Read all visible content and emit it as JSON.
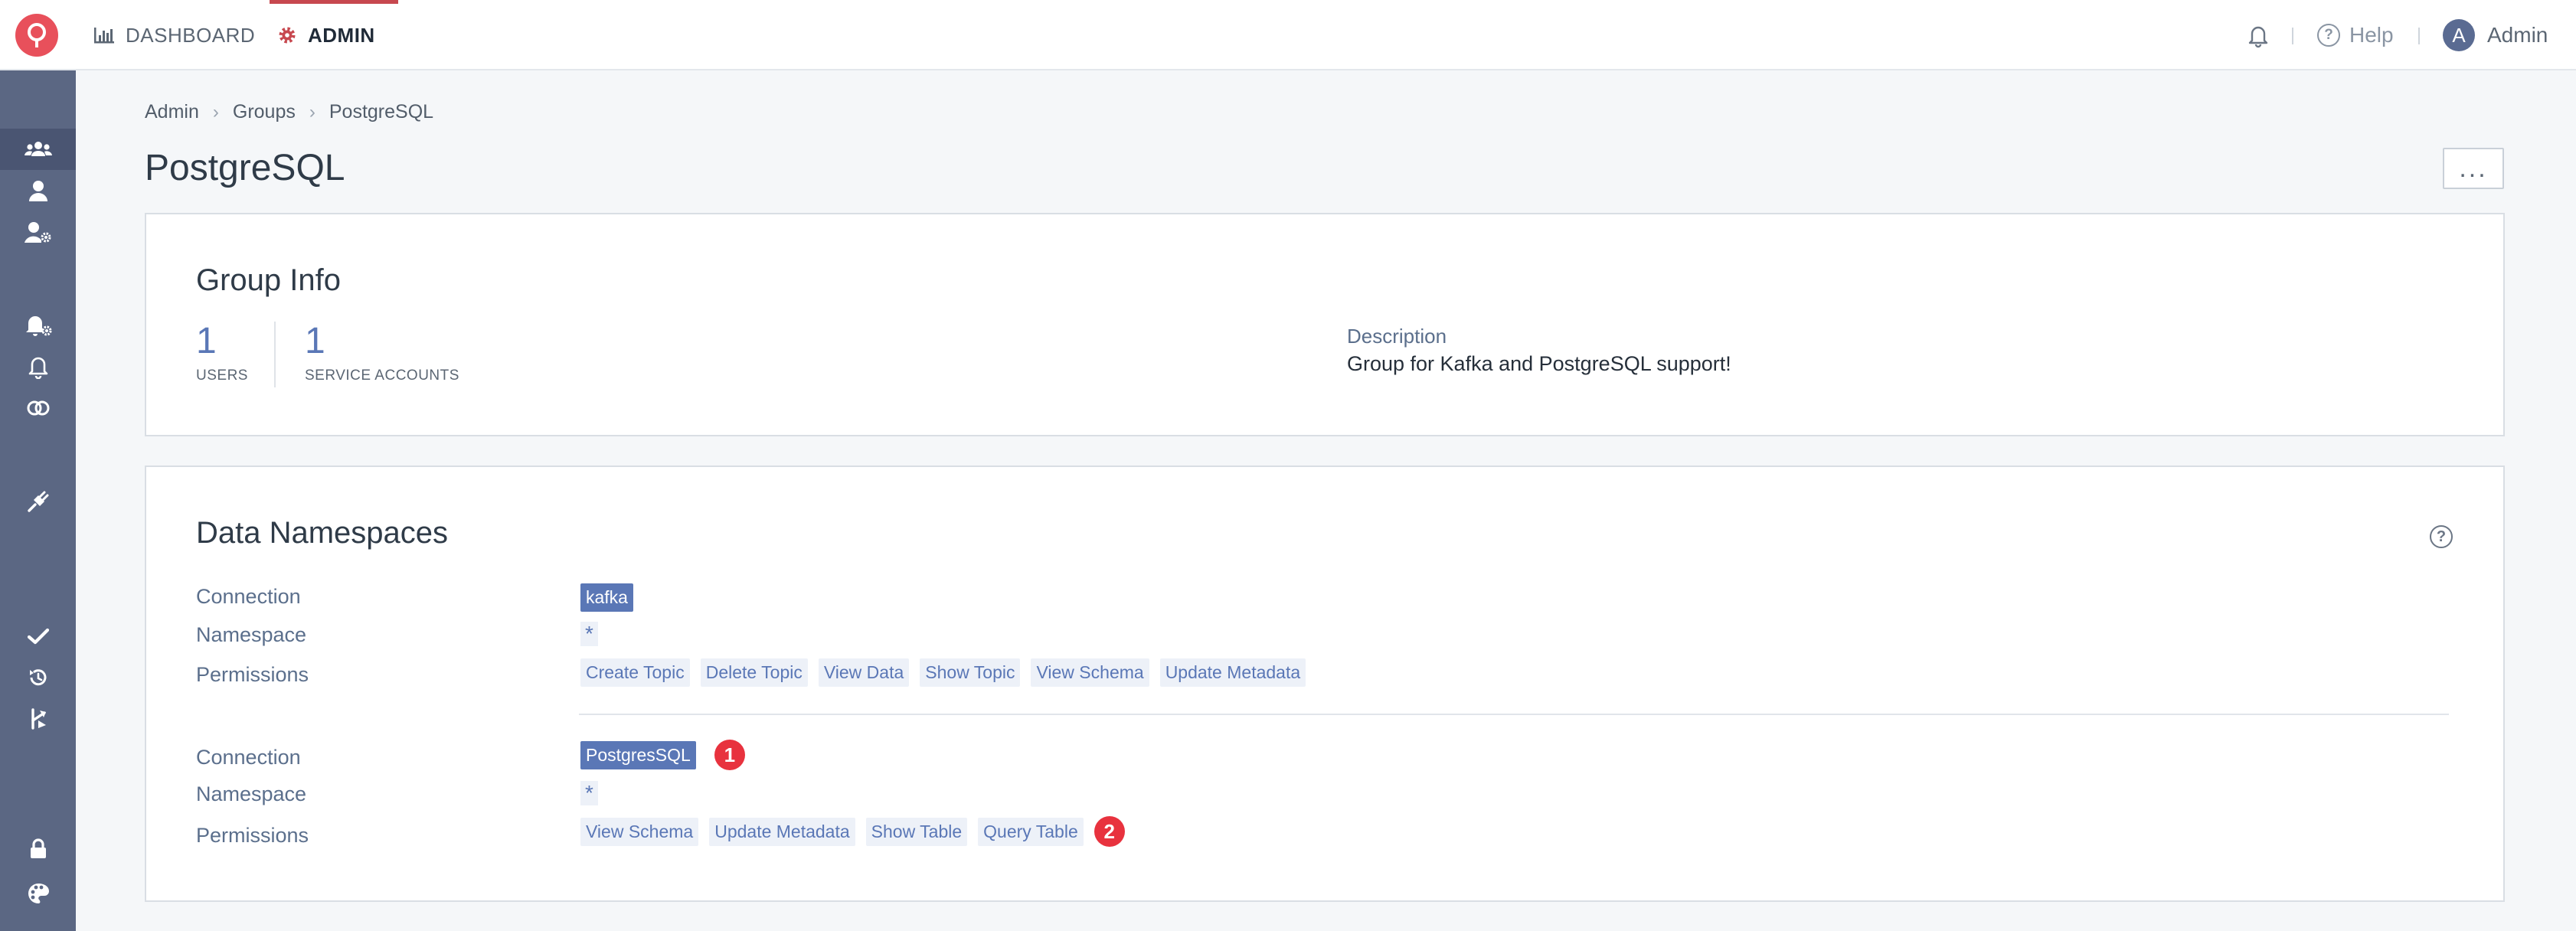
{
  "topbar": {
    "tabs": [
      {
        "label": "DASHBOARD",
        "icon": "bar-chart-icon"
      },
      {
        "label": "ADMIN",
        "icon": "gear-icon"
      }
    ],
    "help_label": "Help",
    "user": {
      "initial": "A",
      "name": "Admin"
    }
  },
  "sidebar": {
    "items": [
      {
        "icon": "groups-icon",
        "active": true
      },
      {
        "icon": "user-icon"
      },
      {
        "icon": "user-settings-icon"
      },
      {
        "icon": "alert-settings-icon"
      },
      {
        "icon": "bell-icon"
      },
      {
        "icon": "connections-icon"
      },
      {
        "icon": "plug-icon"
      },
      {
        "icon": "check-icon"
      },
      {
        "icon": "history-icon"
      },
      {
        "icon": "deploy-icon"
      },
      {
        "icon": "lock-icon"
      },
      {
        "icon": "palette-icon"
      }
    ]
  },
  "breadcrumb": [
    "Admin",
    "Groups",
    "PostgreSQL"
  ],
  "page": {
    "title": "PostgreSQL",
    "more_label": "..."
  },
  "group_info": {
    "heading": "Group Info",
    "users_count": "1",
    "users_label": "USERS",
    "service_accounts_count": "1",
    "service_accounts_label": "SERVICE ACCOUNTS",
    "description_label": "Description",
    "description": "Group for Kafka and PostgreSQL support!"
  },
  "data_namespaces": {
    "heading": "Data Namespaces",
    "labels": {
      "connection": "Connection",
      "namespace": "Namespace",
      "permissions": "Permissions"
    },
    "entries": [
      {
        "connection": "kafka",
        "namespace": "*",
        "permissions": [
          "Create Topic",
          "Delete Topic",
          "View Data",
          "Show Topic",
          "View Schema",
          "Update Metadata"
        ]
      },
      {
        "connection": "PostgresSQL",
        "connection_badge": "1",
        "namespace": "*",
        "permissions": [
          "View Schema",
          "Update Metadata",
          "Show Table",
          "Query Table"
        ],
        "permissions_badge": "2"
      }
    ]
  },
  "colors": {
    "accent": "#5a77b6",
    "sidebar": "#5b6783",
    "brand": "#e8505b",
    "badge": "#e8323e"
  }
}
